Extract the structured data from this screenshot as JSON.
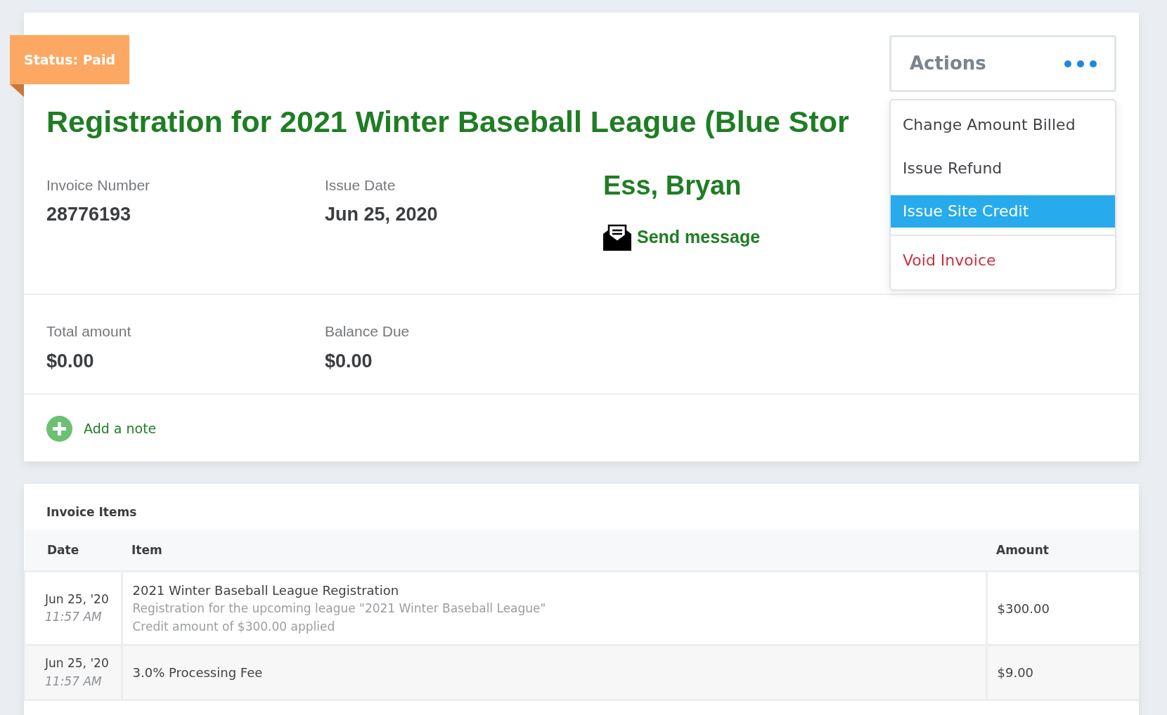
{
  "status": {
    "label": "Status: Paid"
  },
  "title": "Registration for 2021 Winter Baseball League (Blue Stor",
  "fields": [
    {
      "label": "Invoice Number",
      "value": "28776193"
    },
    {
      "label": "Issue Date",
      "value": "Jun 25, 2020"
    }
  ],
  "customer": {
    "name": "Ess, Bryan",
    "link": "Send message"
  },
  "totals": [
    {
      "label": "Total amount",
      "value": "$0.00"
    },
    {
      "label": "Balance Due",
      "value": "$0.00"
    }
  ],
  "note_link": "Add a note",
  "actions": {
    "label": "Actions",
    "menu": [
      {
        "label": "Change Amount Billed",
        "selected": false,
        "kind": "normal"
      },
      {
        "label": "Issue Refund",
        "selected": false,
        "kind": "normal"
      },
      {
        "label": "Issue Site Credit",
        "selected": true,
        "kind": "normal"
      },
      {
        "label": "Void Invoice",
        "selected": false,
        "kind": "danger"
      }
    ]
  },
  "invoice_items": {
    "title": "Invoice Items",
    "columns": [
      "Date",
      "Item",
      "Amount"
    ],
    "rows": [
      {
        "date": "Jun 25, '20",
        "time": "11:57 AM",
        "item": "2021 Winter Baseball League Registration",
        "details": [
          "Registration for the upcoming league \"2021 Winter Baseball League\"",
          "Credit amount of $300.00 applied"
        ],
        "amount": "$300.00"
      },
      {
        "date": "Jun 25, '20",
        "time": "11:57 AM",
        "item": "3.0% Processing Fee",
        "details": [],
        "amount": "$9.00"
      }
    ]
  }
}
